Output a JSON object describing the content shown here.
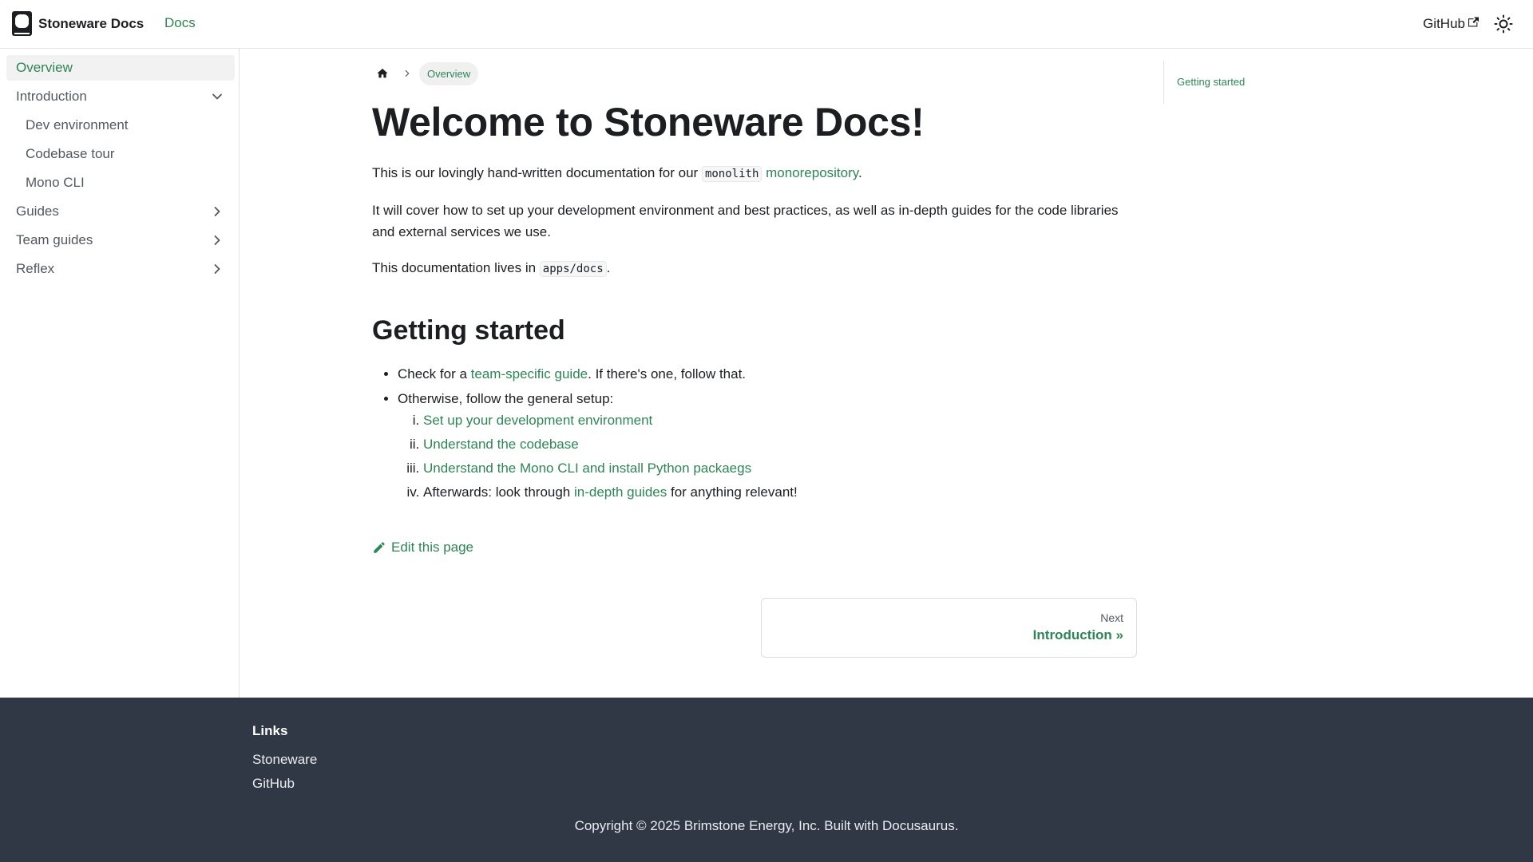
{
  "navbar": {
    "brand_title": "Stoneware Docs",
    "docs_link": "Docs",
    "github_link": "GitHub"
  },
  "sidebar": {
    "items": [
      {
        "label": "Overview",
        "active": true
      },
      {
        "label": "Introduction",
        "expanded": true
      },
      {
        "label": "Dev environment"
      },
      {
        "label": "Codebase tour"
      },
      {
        "label": "Mono CLI"
      },
      {
        "label": "Guides",
        "expanded": false
      },
      {
        "label": "Team guides",
        "expanded": false
      },
      {
        "label": "Reflex",
        "expanded": false
      }
    ]
  },
  "breadcrumb": {
    "current": "Overview"
  },
  "content": {
    "title": "Welcome to Stoneware Docs!",
    "p1_before": "This is our lovingly hand-written documentation for our ",
    "p1_code": "monolith",
    "p1_link": "monorepository",
    "p1_after": ".",
    "p2": "It will cover how to set up your development environment and best practices, as well as in-depth guides for the code libraries and external services we use.",
    "p3_before": "This documentation lives in ",
    "p3_code": "apps/docs",
    "p3_after": ".",
    "h2": "Getting started",
    "bullet1_before": "Check for a ",
    "bullet1_link": "team-specific guide",
    "bullet1_after": ". If there's one, follow that.",
    "bullet2": "Otherwise, follow the general setup:",
    "step1_link": "Set up your development environment",
    "step2_link": "Understand the codebase",
    "step3_link": "Understand the Mono CLI and install Python packaegs",
    "step4_before": "Afterwards: look through ",
    "step4_link": "in-depth guides",
    "step4_after": " for anything relevant!",
    "edit_link": "Edit this page"
  },
  "pager": {
    "sub_label": "Next",
    "label": "Introduction »"
  },
  "toc": {
    "items": [
      "Getting started"
    ]
  },
  "footer": {
    "links_title": "Links",
    "links": [
      "Stoneware",
      "GitHub"
    ],
    "copyright": "Copyright © 2025 Brimstone Energy, Inc. Built with Docusaurus."
  },
  "colors": {
    "accent": "#2e8555",
    "footer_bg": "#303846"
  },
  "icons": [
    "logo-icon",
    "external-link-icon",
    "sun-icon",
    "chevron-down-icon",
    "chevron-right-icon",
    "home-icon",
    "pencil-icon"
  ]
}
